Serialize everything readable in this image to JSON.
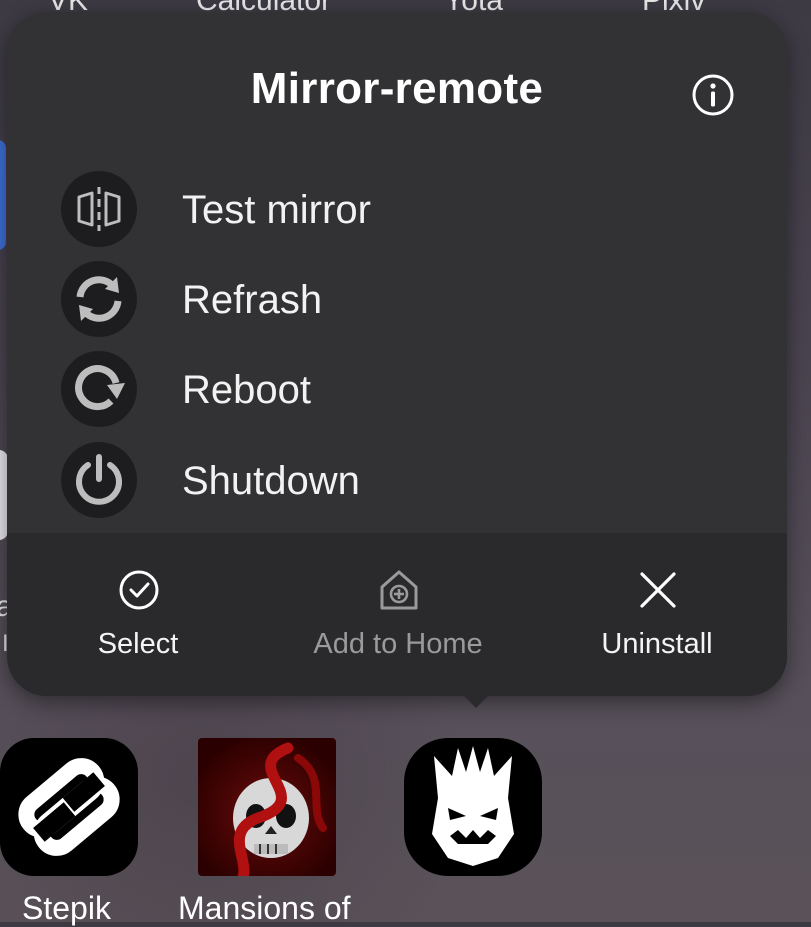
{
  "background_apps": {
    "top_labels": [
      "VK",
      "Calculator",
      "Yota",
      "Pixiv"
    ],
    "left_edge_text": [
      "a",
      "I"
    ]
  },
  "popup": {
    "title": "Mirror-remote",
    "menu_items": [
      {
        "label": "Test mirror",
        "icon": "mirror-icon"
      },
      {
        "label": "Refrash",
        "icon": "refresh-icon"
      },
      {
        "label": "Reboot",
        "icon": "reboot-icon"
      },
      {
        "label": "Shutdown",
        "icon": "power-icon"
      }
    ],
    "actions": [
      {
        "label": "Select",
        "icon": "check-circle-icon",
        "enabled": true
      },
      {
        "label": "Add to Home",
        "icon": "add-home-icon",
        "enabled": false
      },
      {
        "label": "Uninstall",
        "icon": "close-icon",
        "enabled": true
      }
    ]
  },
  "dock_apps": [
    {
      "label": "Stepik",
      "icon": "stepik-icon"
    },
    {
      "label": "Mansions of",
      "icon": "mansions-icon"
    },
    {
      "label": "",
      "icon": "demon-face-icon"
    }
  ],
  "colors": {
    "popup_bg": "#323234",
    "popup_bottom_bg": "#2a2a2c",
    "text_primary": "#ffffff",
    "text_disabled": "#9a9a9c",
    "icon_circle_bg": "#1d1d1f",
    "accent_red": "#b01010"
  }
}
